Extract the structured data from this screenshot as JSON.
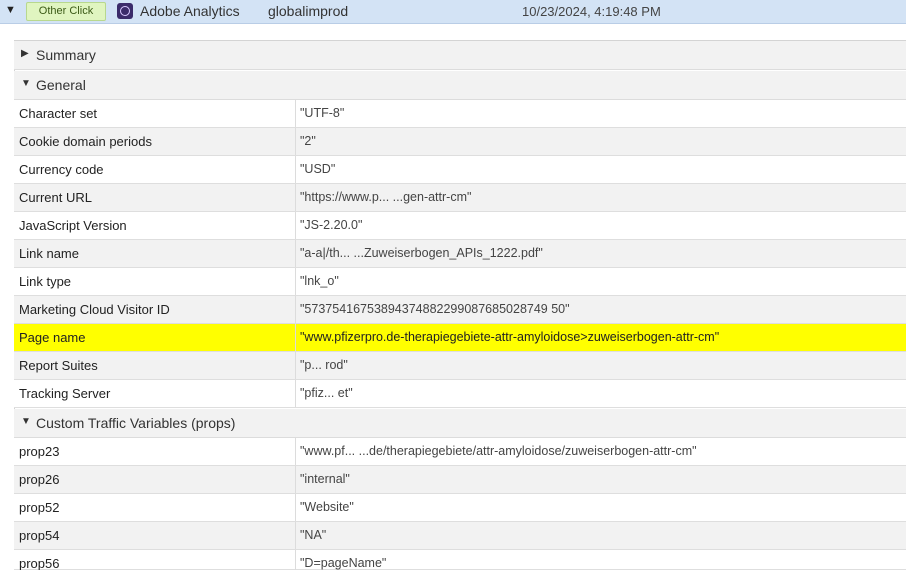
{
  "header": {
    "event_badge": "Other Click",
    "app_name": "Adobe Analytics",
    "report_suite": "globalimprod",
    "timestamp": "10/23/2024, 4:19:48 PM",
    "accent_color": "#d3e3f5",
    "badge_color": "#e0f5c0"
  },
  "sections": {
    "summary": "Summary",
    "general": "General",
    "props": "Custom Traffic Variables (props)"
  },
  "general_rows": [
    {
      "key": "Character set",
      "value": "\"UTF-8\""
    },
    {
      "key": "Cookie domain periods",
      "value": "\"2\""
    },
    {
      "key": "Currency code",
      "value": "\"USD\""
    },
    {
      "key": "Current URL",
      "value": "\"https://www.p... ...gen-attr-cm\""
    },
    {
      "key": "JavaScript Version",
      "value": "\"JS-2.20.0\""
    },
    {
      "key": "Link name",
      "value": "\"a-a|/th... ...Zuweiserbogen_APIs_1222.pdf\""
    },
    {
      "key": "Link type",
      "value": "\"lnk_o\""
    },
    {
      "key": "Marketing Cloud Visitor ID",
      "value": "\"57375416753894374882299087685028749 50\""
    },
    {
      "key": "Page name",
      "value": "\"www.pfizerpro.de-therapiegebiete-attr-amyloidose>zuweiserbogen-attr-cm\""
    },
    {
      "key": "Report Suites",
      "value": "\"p... rod\""
    },
    {
      "key": "Tracking Server",
      "value": "\"pfiz... et\""
    }
  ],
  "props_rows": [
    {
      "key": "prop23",
      "value": "\"www.pf... ...de/therapiegebiete/attr-amyloidose/zuweiserbogen-attr-cm\""
    },
    {
      "key": "prop26",
      "value": "\"internal\""
    },
    {
      "key": "prop52",
      "value": "\"Website\""
    },
    {
      "key": "prop54",
      "value": "\"NA\""
    },
    {
      "key": "prop56",
      "value": "\"D=pageName\""
    }
  ],
  "highlight_color": "#ffff00"
}
